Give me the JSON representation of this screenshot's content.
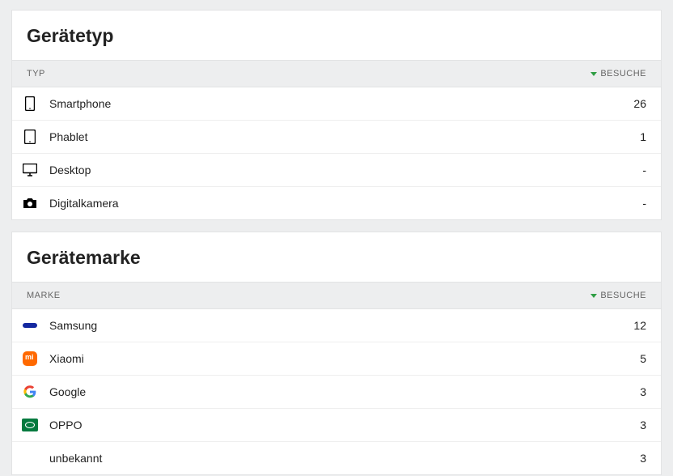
{
  "device_type": {
    "title": "Gerätetyp",
    "columns": {
      "left": "TYP",
      "right": "BESUCHE"
    },
    "rows": [
      {
        "icon": "smartphone",
        "label": "Smartphone",
        "value": "26"
      },
      {
        "icon": "phablet",
        "label": "Phablet",
        "value": "1"
      },
      {
        "icon": "desktop",
        "label": "Desktop",
        "value": "-"
      },
      {
        "icon": "camera",
        "label": "Digitalkamera",
        "value": "-"
      }
    ]
  },
  "device_brand": {
    "title": "Gerätemarke",
    "columns": {
      "left": "MARKE",
      "right": "BESUCHE"
    },
    "rows": [
      {
        "icon": "samsung",
        "label": "Samsung",
        "value": "12"
      },
      {
        "icon": "xiaomi",
        "label": "Xiaomi",
        "value": "5"
      },
      {
        "icon": "google",
        "label": "Google",
        "value": "3"
      },
      {
        "icon": "oppo",
        "label": "OPPO",
        "value": "3"
      },
      {
        "icon": "",
        "label": "unbekannt",
        "value": "3"
      }
    ]
  }
}
